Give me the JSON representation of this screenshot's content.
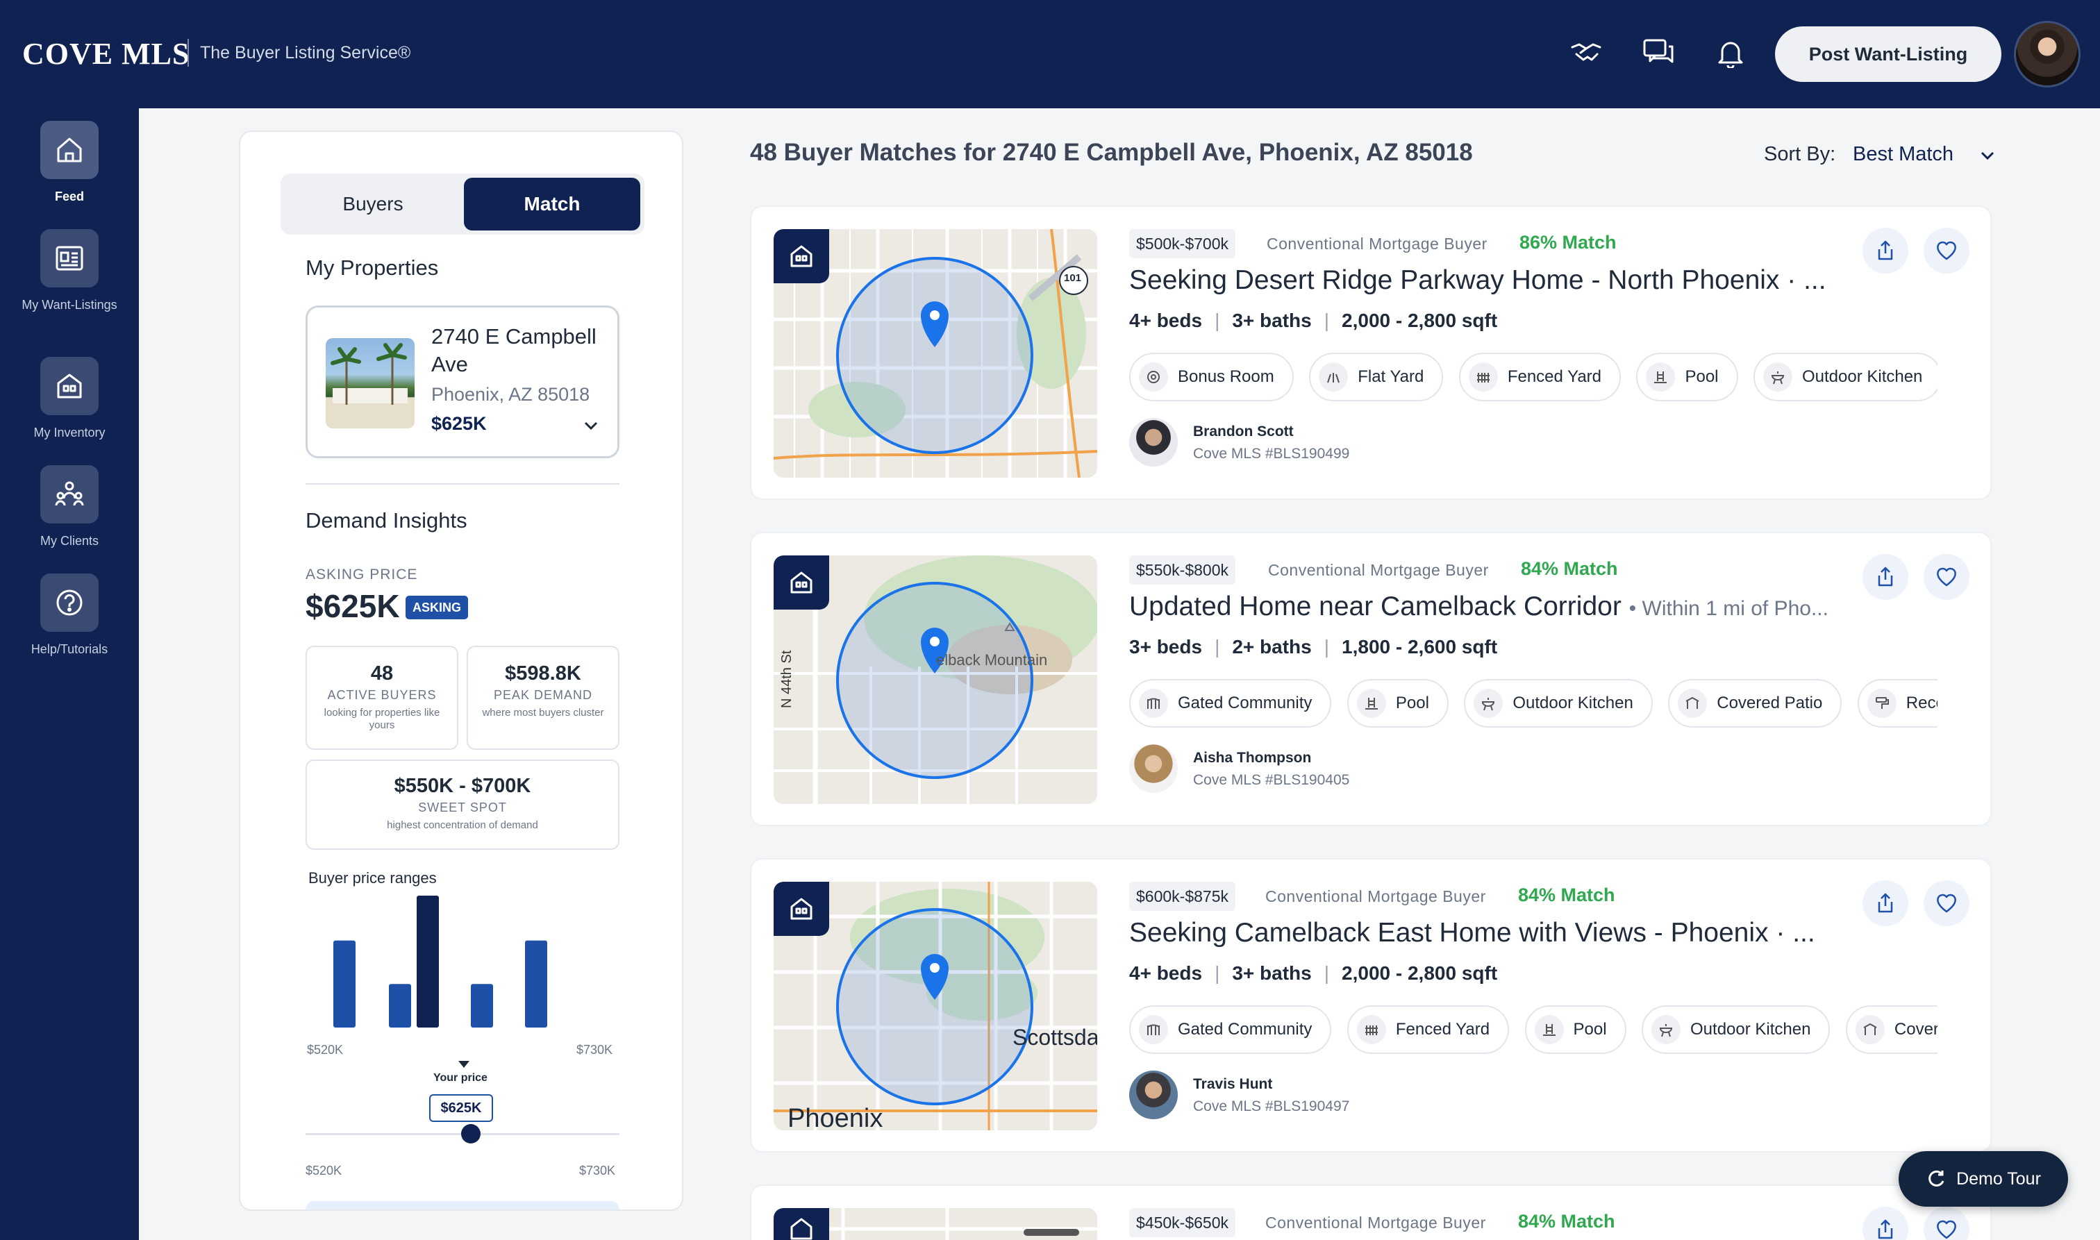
{
  "app": {
    "logo": "COVE MLS",
    "tagline": "The Buyer Listing Service®",
    "post_button": "Post Want-Listing"
  },
  "nav": [
    {
      "label": "Feed",
      "icon": "home-icon",
      "active": true
    },
    {
      "label": "My Want-Listings",
      "icon": "listing-icon",
      "active": false
    },
    {
      "label": "My Inventory",
      "icon": "inventory-house-icon",
      "active": false
    },
    {
      "label": "My Clients",
      "icon": "clients-icon",
      "active": false
    },
    {
      "label": "Help/Tutorials",
      "icon": "help-icon",
      "active": false
    }
  ],
  "panel": {
    "tabs": [
      "Buyers",
      "Match"
    ],
    "active_tab": "Match",
    "my_properties_title": "My Properties",
    "property": {
      "address": "2740 E Campbell Ave",
      "city": "Phoenix, AZ 85018",
      "price": "$625K"
    },
    "demand_title": "Demand Insights",
    "asking_label": "ASKING PRICE",
    "asking_price": "$625K",
    "asking_badge": "ASKING",
    "stats": [
      {
        "value": "48",
        "label": "ACTIVE BUYERS",
        "sub": "looking for properties like yours"
      },
      {
        "value": "$598.8K",
        "label": "PEAK DEMAND",
        "sub": "where most buyers cluster"
      },
      {
        "value": "$550K - $700K",
        "label": "SWEET SPOT",
        "sub": "highest concentration of demand"
      }
    ],
    "chart_title": "Buyer price ranges",
    "axis_min": "$520K",
    "axis_max": "$730K",
    "your_price_label": "Your price",
    "your_price": "$625K",
    "slider_min": "$520K",
    "slider_max": "$730K"
  },
  "chart_data": {
    "type": "bar",
    "title": "Buyer price ranges",
    "x_range": [
      "$520K",
      "$730K"
    ],
    "values": [
      0.66,
      0.33,
      1.0,
      0.33,
      0.66
    ],
    "marker": "$625K"
  },
  "results": {
    "title": "48 Buyer Matches for 2740 E Campbell Ave, Phoenix, AZ 85018",
    "sort_label": "Sort By:",
    "sort_value": "Best Match"
  },
  "cards": [
    {
      "price_range": "$500k-$700k",
      "buyer_type": "Conventional Mortgage Buyer",
      "match": "86% Match",
      "title": "Seeking Desert Ridge Parkway Home - North Phoenix · ...",
      "subtitle": "",
      "beds": "4+ beds",
      "baths": "3+ baths",
      "sqft": "2,000 - 2,800 sqft",
      "features": [
        "Bonus Room",
        "Flat Yard",
        "Fenced Yard",
        "Pool",
        "Outdoor Kitchen"
      ],
      "agent_name": "Brandon Scott",
      "agent_id": "Cove MLS #BLS190499",
      "map_label": "101"
    },
    {
      "price_range": "$550k-$800k",
      "buyer_type": "Conventional Mortgage Buyer",
      "match": "84% Match",
      "title": "Updated Home near Camelback Corridor",
      "subtitle": "• Within 1 mi of Pho...",
      "beds": "3+ beds",
      "baths": "2+ baths",
      "sqft": "1,800 - 2,600 sqft",
      "features": [
        "Gated Community",
        "Pool",
        "Outdoor Kitchen",
        "Covered Patio",
        "Recen"
      ],
      "agent_name": "Aisha Thompson",
      "agent_id": "Cove MLS #BLS190405",
      "map_label": "elback Mountain",
      "map_street": "N 44th St"
    },
    {
      "price_range": "$600k-$875k",
      "buyer_type": "Conventional Mortgage Buyer",
      "match": "84% Match",
      "title": "Seeking Camelback East Home with Views - Phoenix · ...",
      "subtitle": "",
      "beds": "4+ beds",
      "baths": "3+ baths",
      "sqft": "2,000 - 2,800 sqft",
      "features": [
        "Gated Community",
        "Fenced Yard",
        "Pool",
        "Outdoor Kitchen",
        "Coverec"
      ],
      "agent_name": "Travis Hunt",
      "agent_id": "Cove MLS #BLS190497",
      "map_label": "Scottsda",
      "map_city": "Phoenix"
    },
    {
      "price_range": "$450k-$650k",
      "buyer_type": "Conventional Mortgage Buyer",
      "match": "84% Match"
    }
  ],
  "demo_tour": "Demo Tour",
  "colors": {
    "navy": "#0f2251",
    "match_green": "#2fa84f",
    "bar_blue": "#1e50a8",
    "radius_blue": "#1a73e8"
  }
}
